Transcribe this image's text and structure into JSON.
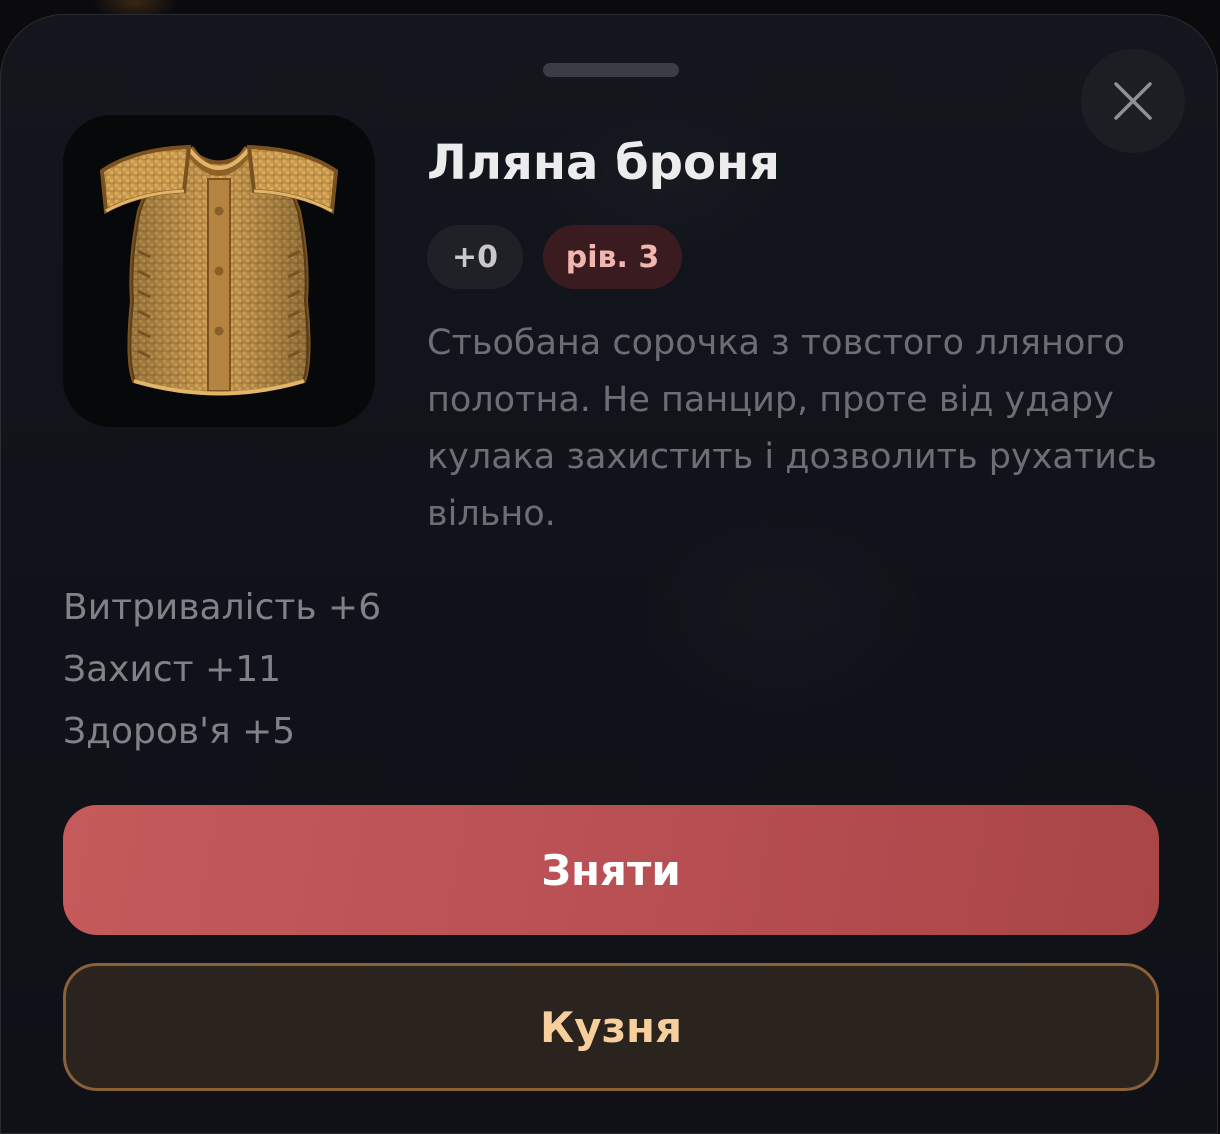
{
  "item": {
    "title": "Лляна броня",
    "enhancement_badge": "+0",
    "level_badge": "рів. 3",
    "description": "Стьобана сорочка з товстого лляного полотна. Не панцир, проте від удару кулака захистить і дозволить рухатись вільно.",
    "image_icon": "linen-armor-vest-icon"
  },
  "stats": [
    "Витривалість +6",
    "Захист +11",
    "Здоров'я +5"
  ],
  "actions": {
    "unequip_label": "Зняти",
    "forge_label": "Кузня"
  },
  "colors": {
    "unequip_button": "#c0575a",
    "forge_border": "#8a6136",
    "forge_text": "#f6cf9c",
    "level_badge_bg": "#3a1c20",
    "level_badge_text": "#f1b6b0"
  }
}
